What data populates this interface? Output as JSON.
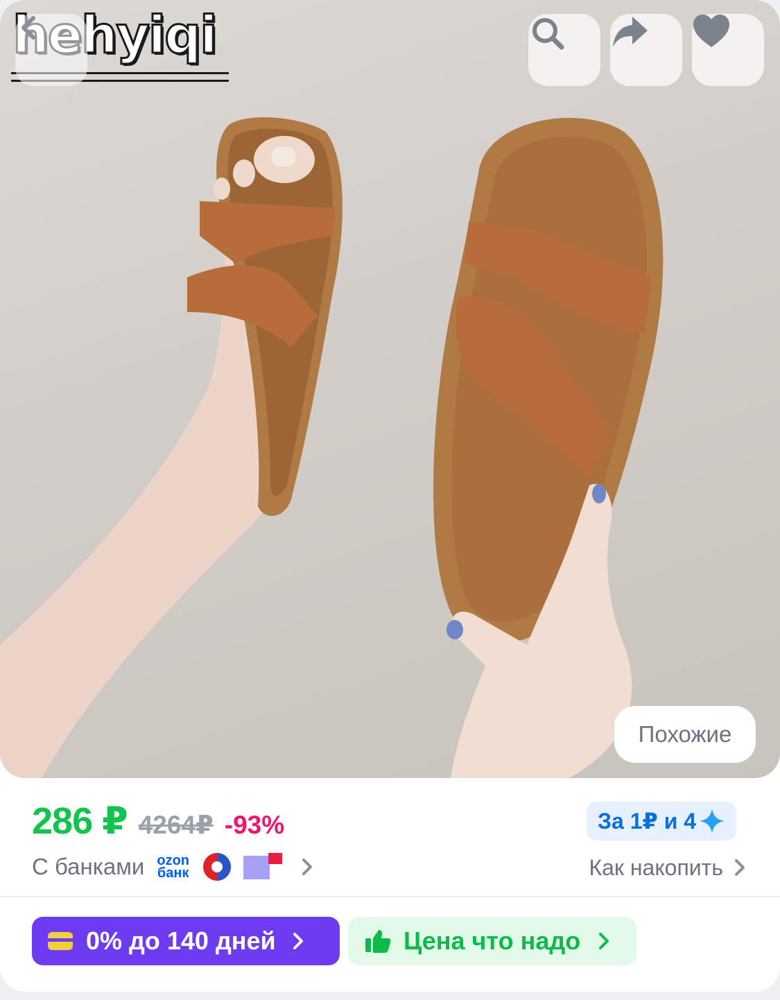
{
  "product_image": {
    "watermark": "hehyiqi",
    "icons": {
      "back": "chevron-left-icon",
      "search": "search-icon",
      "share": "share-icon",
      "favorite": "heart-icon"
    },
    "similar_label": "Похожие"
  },
  "price": {
    "current": "286 ₽",
    "old": "4264₽",
    "discount": "-93%",
    "banks_label": "С банками",
    "ozon_bank_top": "ozon",
    "ozon_bank_bottom": "банк"
  },
  "points": {
    "badge_label": "За 1₽ и 4",
    "link_label": "Как накопить"
  },
  "actions": {
    "installment_label": "0% до 140 дней",
    "fair_price_label": "Цена что надо"
  },
  "colors": {
    "price_green": "#10c44c",
    "discount_pink": "#f0166d",
    "installment_purple": "#6e3cf0",
    "points_blue": "#0a6fd8"
  }
}
